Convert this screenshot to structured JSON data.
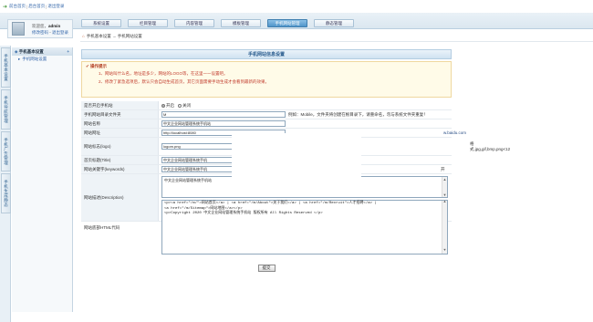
{
  "topbar": {
    "home_link": "前台首页",
    "admin_home_link": "后台首页",
    "logout_link": "退出登录",
    "sep": "|"
  },
  "tabs": [
    {
      "label": "系统设置",
      "active": false
    },
    {
      "label": "栏目管理",
      "active": false
    },
    {
      "label": "内容管理",
      "active": false
    },
    {
      "label": "模板管理",
      "active": false
    },
    {
      "label": "手机网站管理",
      "active": true
    },
    {
      "label": "静态管理",
      "active": false
    }
  ],
  "user": {
    "welcome": "欢迎您，",
    "name": "admin",
    "edit_pwd": "修改密码",
    "sep": "-",
    "logout": "退出登录"
  },
  "leftnav": [
    "手机基本设置",
    "手机导航管理",
    "手机广告管理",
    "手机生成静态"
  ],
  "submenu": {
    "header": "手机基本设置",
    "plus": "+",
    "items": [
      "手机网站设置"
    ]
  },
  "breadcrumb": {
    "home_icon": "⌂",
    "text": "手机基本设置 → 手机网站设置"
  },
  "form": {
    "title": "手机网站信息设置",
    "notice_title": "操作提示",
    "notice_lines": [
      "1、网站叫什么名，地址是多少，网站的LOGO等，在这里一一设置吧。",
      "2、修改了紧急选项后，默认只会自动生成首页，其它页面需要手动生成才会看到最新的效果。"
    ],
    "rows": {
      "enable": {
        "label": "是否开启手机站",
        "on": "开启",
        "off": "关闭"
      },
      "folder": {
        "label": "手机网站目录文件夹",
        "value": "M",
        "hint": "例如：Mobile，文件夹将创建在根目录下，请重命名，勿与系统文件夹重复！"
      },
      "name": {
        "label": "网站名称",
        "value": "中文企业网站管理系统手机站"
      },
      "url": {
        "label": "网站网址",
        "value": "http://localhost:8080",
        "hint": "w.baidu.com"
      },
      "logo": {
        "label": "网站标志(logo)",
        "value": "logom.png",
        "hint": "格式.jpg,gif,bmp,png<12"
      },
      "seotitle": {
        "label": "首页标题(Title)",
        "value": "中文企业网站管理系统手机"
      },
      "keywords": {
        "label": "网站关键字(keywords)",
        "value": "中文企业网站管理系统手机",
        "hint": "开"
      },
      "description": {
        "label": "网站描述(Description)",
        "value": "中文企业网站管理系统手机站"
      },
      "footer": {
        "label": "网站底部HTML代码",
        "line1": "<p><a href=\"/m/\">网站首页</a> | <a href=\"/m/About\">关于我们</a> | <a href=\"/m/Recruit\">人才招聘</a> |",
        "line2": "<a href=\"/m/Sitemap\">网站地图</a></p>",
        "line3": "<p>Copyright 2020 中文企业网站管理系统手机站 版权所有 All Rights Reserved </p>"
      }
    },
    "submit_label": "提交"
  },
  "colors": {
    "accent": "#4f94c9",
    "notice_text": "#c03a2b",
    "link": "#3366aa"
  }
}
